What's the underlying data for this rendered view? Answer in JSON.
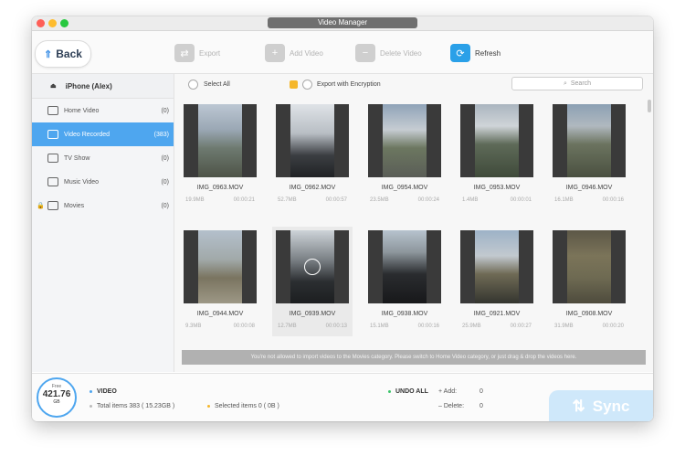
{
  "window": {
    "title": "Video Manager"
  },
  "toolbar": {
    "back_label": "Back",
    "export_label": "Export",
    "add_video_label": "Add Video",
    "delete_video_label": "Delete Video",
    "refresh_label": "Refresh"
  },
  "sidebar": {
    "device_name": "iPhone (Alex)",
    "items": [
      {
        "label": "Home Video",
        "count": "(0)",
        "icon": "home-video-icon"
      },
      {
        "label": "Video Recorded",
        "count": "(383)",
        "icon": "video-recorded-icon"
      },
      {
        "label": "TV Show",
        "count": "(0)",
        "icon": "tv-icon"
      },
      {
        "label": "Music Video",
        "count": "(0)",
        "icon": "music-video-icon"
      },
      {
        "label": "Movies",
        "count": "(0)",
        "icon": "movies-icon"
      }
    ]
  },
  "filters": {
    "select_all_label": "Select All",
    "export_encryption_label": "Export with Encryption",
    "search_placeholder": "Search"
  },
  "videos": [
    {
      "name": "IMG_0963.MOV",
      "size": "19.9MB",
      "duration": "00:00:21"
    },
    {
      "name": "IMG_0962.MOV",
      "size": "52.7MB",
      "duration": "00:00:57"
    },
    {
      "name": "IMG_0954.MOV",
      "size": "23.5MB",
      "duration": "00:00:24"
    },
    {
      "name": "IMG_0953.MOV",
      "size": "1.4MB",
      "duration": "00:00:01"
    },
    {
      "name": "IMG_0946.MOV",
      "size": "16.1MB",
      "duration": "00:00:16"
    },
    {
      "name": "IMG_0944.MOV",
      "size": "9.3MB",
      "duration": "00:00:08"
    },
    {
      "name": "IMG_0939.MOV",
      "size": "12.7MB",
      "duration": "00:00:13"
    },
    {
      "name": "IMG_0938.MOV",
      "size": "15.1MB",
      "duration": "00:00:16"
    },
    {
      "name": "IMG_0921.MOV",
      "size": "25.9MB",
      "duration": "00:00:27"
    },
    {
      "name": "IMG_0908.MOV",
      "size": "31.9MB",
      "duration": "00:00:20"
    }
  ],
  "notice": "You're not allowed to import videos to the Movies category. Please switch to Home Video category, or just drag & drop the videos here.",
  "footer": {
    "free_label": "Free",
    "free_value": "421.76",
    "free_unit": "GB",
    "section_label": "VIDEO",
    "total_items": "Total items 383 ( 15.23GB )",
    "selected_items": "Selected items 0 ( 0B )",
    "undo_all_label": "UNDO ALL",
    "add_label": "+ Add:",
    "add_value": "0",
    "delete_label": "– Delete:",
    "delete_value": "0",
    "sync_label": "Sync"
  },
  "colors": {
    "accent": "#4ea6ef",
    "refresh_blue": "#2aa0e8",
    "undo_dot": "#3cc46b",
    "selected_dot": "#f5b72b"
  }
}
